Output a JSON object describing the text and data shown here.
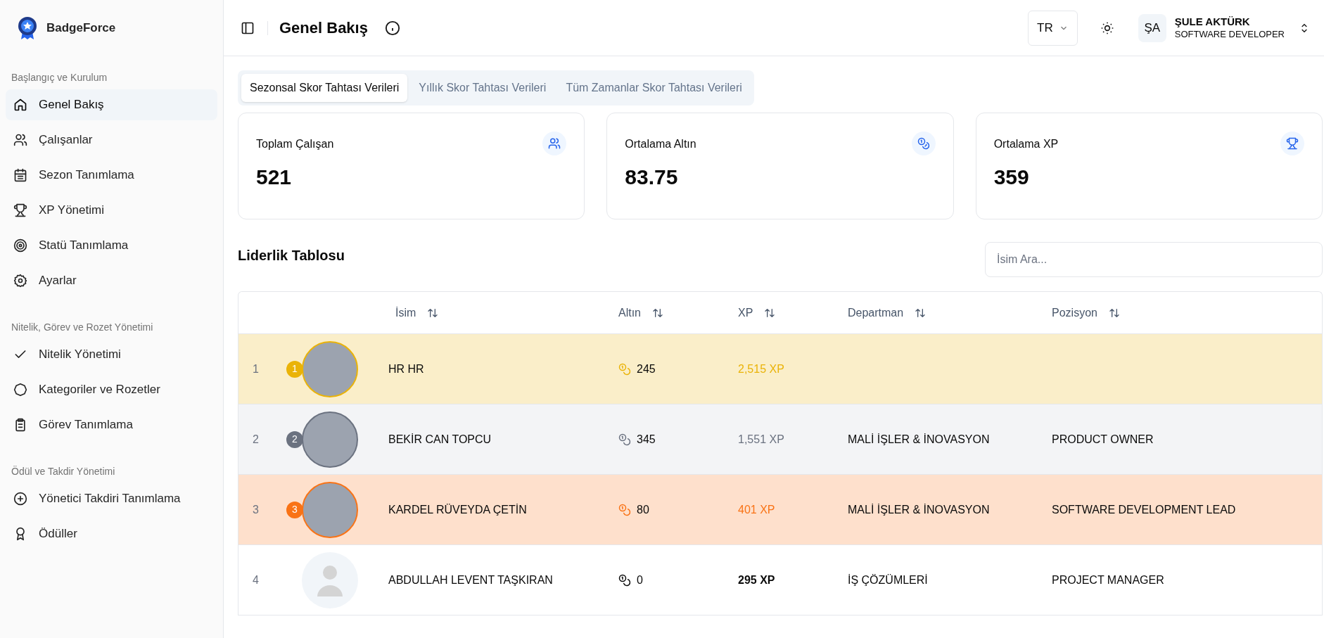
{
  "sidebar": {
    "brand": "BadgeForce",
    "sections": [
      {
        "title": "Başlangıç ve Kurulum",
        "items": [
          {
            "label": "Genel Bakış",
            "selected": true
          },
          {
            "label": "Çalışanlar",
            "selected": false
          },
          {
            "label": "Sezon Tanımlama",
            "selected": false
          },
          {
            "label": "XP Yönetimi",
            "selected": false
          },
          {
            "label": "Statü Tanımlama",
            "selected": false
          },
          {
            "label": "Ayarlar",
            "selected": false
          }
        ]
      },
      {
        "title": "Nitelik, Görev ve Rozet Yönetimi",
        "items": [
          {
            "label": "Nitelik Yönetimi",
            "selected": false
          },
          {
            "label": "Kategoriler ve Rozetler",
            "selected": false
          },
          {
            "label": "Görev Tanımlama",
            "selected": false
          }
        ]
      },
      {
        "title": "Ödül ve Takdir Yönetimi",
        "items": [
          {
            "label": "Yönetici Takdiri Tanımlama",
            "selected": false
          },
          {
            "label": "Ödüller",
            "selected": false
          }
        ]
      }
    ]
  },
  "header": {
    "title": "Genel Bakış",
    "language": "TR",
    "user": {
      "initials": "ŞA",
      "name": "ŞULE AKTÜRK",
      "role": "SOFTWARE DEVELOPER"
    }
  },
  "tabs": [
    {
      "label": "Sezonsal Skor Tahtası Verileri",
      "selected": true
    },
    {
      "label": "Yıllık Skor Tahtası Verileri",
      "selected": false
    },
    {
      "label": "Tüm Zamanlar Skor Tahtası Verileri",
      "selected": false
    }
  ],
  "stats": [
    {
      "label": "Toplam Çalışan",
      "value": "521"
    },
    {
      "label": "Ortalama Altın",
      "value": "83.75"
    },
    {
      "label": "Ortalama XP",
      "value": "359"
    }
  ],
  "leaderboard": {
    "title": "Liderlik Tablosu",
    "search": {
      "placeholder": "İsim Ara..."
    },
    "columns": [
      "İsim",
      "Altın",
      "XP",
      "Departman",
      "Pozisyon"
    ],
    "rows": [
      {
        "rank": "1",
        "badge": "1",
        "color": "#eab308",
        "name": "HR HR",
        "gold": "245",
        "xp": "2,515 XP"
      },
      {
        "rank": "2",
        "badge": "2",
        "color": "#6b7280",
        "name": "BEKİR CAN TOPCU",
        "gold": "345",
        "xp": "1,551 XP",
        "department": "MALİ İŞLER & İNOVASYON",
        "position": "PRODUCT OWNER"
      },
      {
        "rank": "3",
        "badge": "3",
        "color": "#f97316",
        "name": "KARDEL RÜVEYDA ÇETİN",
        "gold": "80",
        "xp": "401 XP",
        "department": "MALİ İŞLER & İNOVASYON",
        "position": "SOFTWARE DEVELOPMENT LEAD"
      },
      {
        "rank": "4",
        "name": "ABDULLAH LEVENT TAŞKIRAN",
        "gold": "0",
        "xp": "295 XP",
        "department": "İŞ ÇÖZÜMLERİ",
        "position": "PROJECT MANAGER"
      }
    ]
  }
}
